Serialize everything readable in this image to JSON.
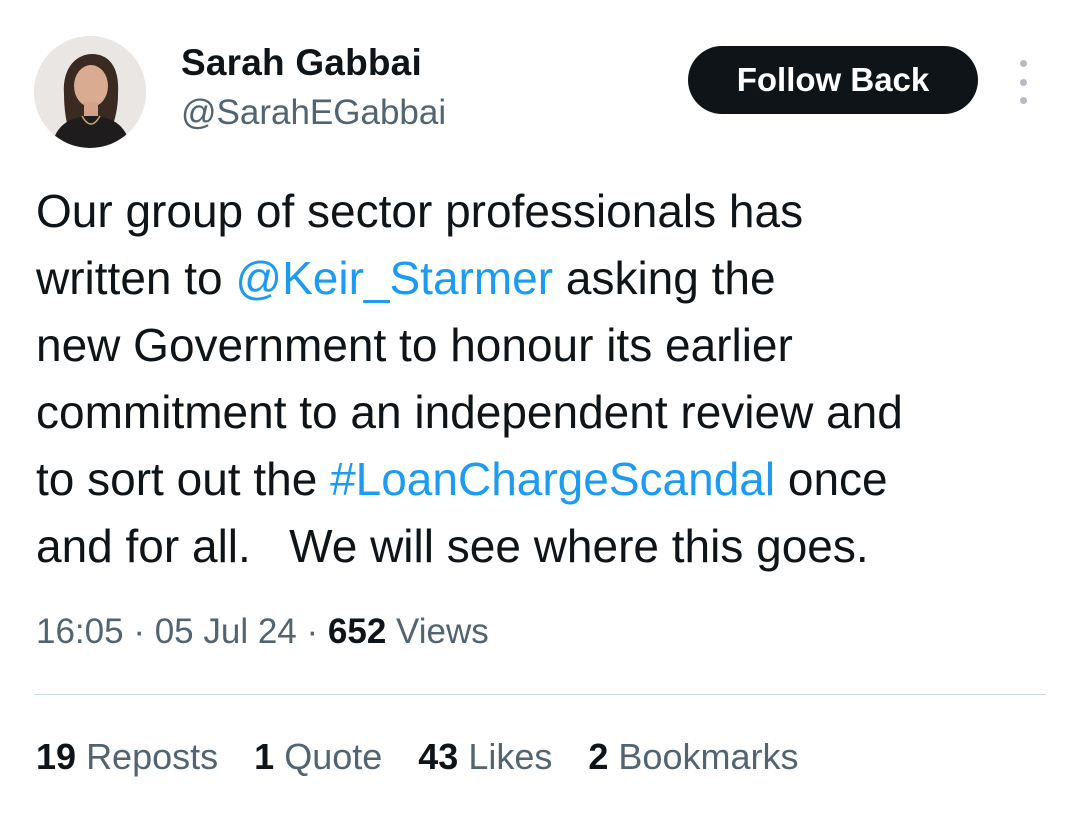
{
  "author": {
    "name": "Sarah Gabbai",
    "handle": "@SarahEGabbai"
  },
  "follow_button": {
    "label": "Follow Back"
  },
  "more_icon": "more-vertical-icon",
  "tweet": {
    "lines": [
      {
        "parts": [
          "Our group of sector professionals has"
        ]
      },
      {
        "before": "written to ",
        "link": "@Keir_Starmer",
        "after": " asking the"
      },
      {
        "parts": [
          "new Government to honour its earlier"
        ]
      },
      {
        "parts": [
          "commitment to an independent review and"
        ]
      },
      {
        "before": "to sort out the ",
        "link": "#LoanChargeScandal",
        "after": " once"
      },
      {
        "parts": [
          "and for all.   We will see where this goes."
        ]
      }
    ]
  },
  "meta": {
    "time": "16:05",
    "separator": "·",
    "date": "05 Jul 24",
    "views_count": "652",
    "views_label": "Views"
  },
  "stats": [
    {
      "count": "19",
      "label": "Reposts"
    },
    {
      "count": "1",
      "label": "Quote"
    },
    {
      "count": "43",
      "label": "Likes"
    },
    {
      "count": "2",
      "label": "Bookmarks"
    }
  ],
  "colors": {
    "text": "#0f1419",
    "secondary": "#536471",
    "link": "#1d9bf0",
    "button_bg": "#0f1419",
    "divider": "#cfd9de"
  }
}
